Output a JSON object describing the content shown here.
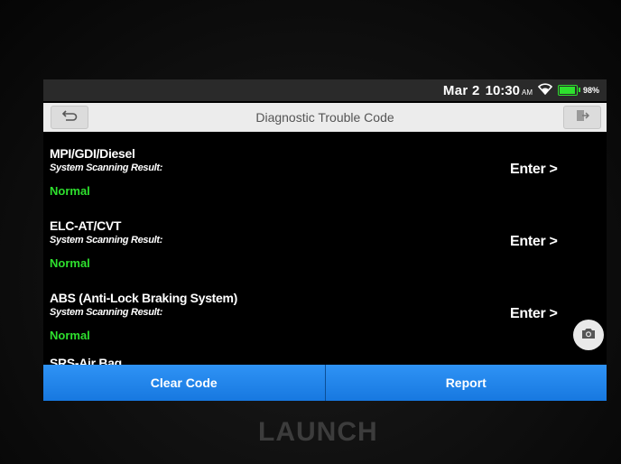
{
  "status_bar": {
    "date": "Mar 2",
    "time": "10:30",
    "ampm": "AM",
    "battery_percent": "98%",
    "battery_color": "#2ee02e"
  },
  "header": {
    "title": "Diagnostic Trouble Code",
    "back_icon": "back-arrow-icon",
    "exit_icon": "exit-icon"
  },
  "systems": [
    {
      "name": "MPI/GDI/Diesel",
      "result_label": "System Scanning Result:",
      "result": "Normal",
      "enter_label": "Enter >"
    },
    {
      "name": "ELC-AT/CVT",
      "result_label": "System Scanning Result:",
      "result": "Normal",
      "enter_label": "Enter >"
    },
    {
      "name": "ABS (Anti-Lock Braking System)",
      "result_label": "System Scanning Result:",
      "result": "Normal",
      "enter_label": "Enter >"
    },
    {
      "name": "SRS-Air Bag"
    }
  ],
  "camera_icon": "camera-icon",
  "footer": {
    "clear_code_label": "Clear Code",
    "report_label": "Report",
    "button_color": "#1f86ec"
  },
  "device": {
    "brand": "LAUNCH"
  }
}
